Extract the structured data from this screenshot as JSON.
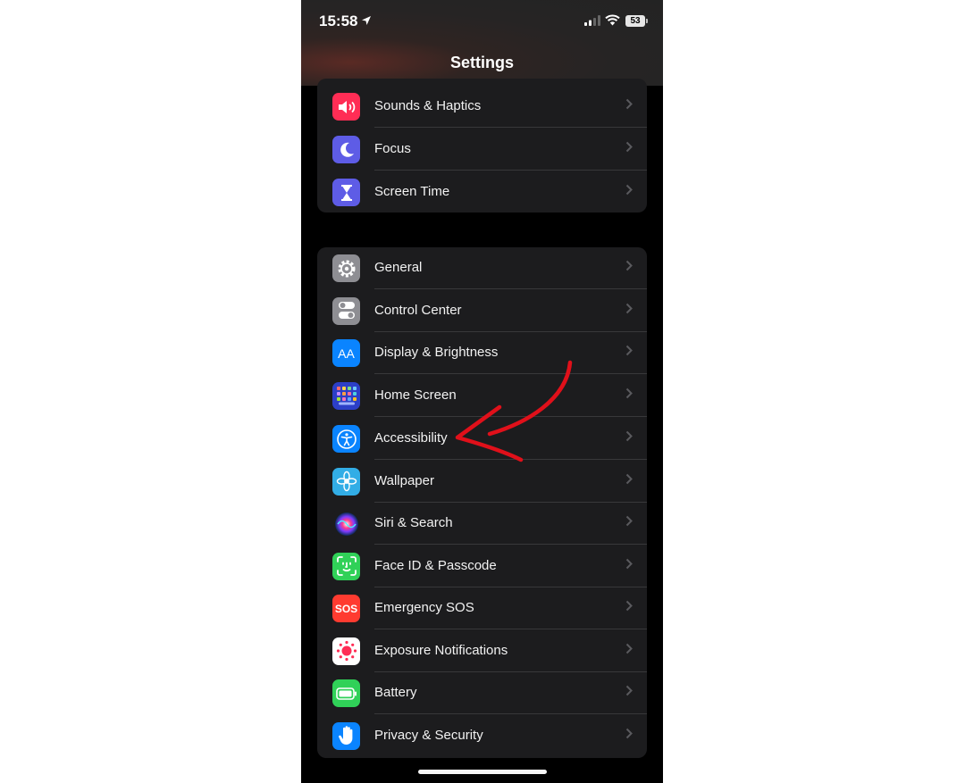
{
  "status_bar": {
    "time": "15:58",
    "battery": "53"
  },
  "nav": {
    "title": "Settings"
  },
  "group1": [
    {
      "label": "Sounds & Haptics",
      "icon": "speaker-icon",
      "color": "#ff2d55"
    },
    {
      "label": "Focus",
      "icon": "moon-icon",
      "color": "#5e5ce6"
    },
    {
      "label": "Screen Time",
      "icon": "hourglass-icon",
      "color": "#5e5ce6"
    }
  ],
  "group2": [
    {
      "label": "General",
      "icon": "gear-icon",
      "color": "#8e8e93"
    },
    {
      "label": "Control Center",
      "icon": "toggles-icon",
      "color": "#8e8e93"
    },
    {
      "label": "Display & Brightness",
      "icon": "text-size-icon",
      "color": "#0a84ff",
      "icon_text": "AA"
    },
    {
      "label": "Home Screen",
      "icon": "app-grid-icon",
      "color": "#2c3fc7"
    },
    {
      "label": "Accessibility",
      "icon": "accessibility-icon",
      "color": "#0a84ff"
    },
    {
      "label": "Wallpaper",
      "icon": "flower-icon",
      "color": "#32ade6"
    },
    {
      "label": "Siri & Search",
      "icon": "siri-icon",
      "color": "#1c1c1e"
    },
    {
      "label": "Face ID & Passcode",
      "icon": "face-id-icon",
      "color": "#30d158"
    },
    {
      "label": "Emergency SOS",
      "icon": "sos-icon",
      "color": "#ff3b30",
      "icon_text": "SOS"
    },
    {
      "label": "Exposure Notifications",
      "icon": "exposure-icon",
      "color": "#ffffff"
    },
    {
      "label": "Battery",
      "icon": "battery-icon",
      "color": "#30d158"
    },
    {
      "label": "Privacy & Security",
      "icon": "hand-icon",
      "color": "#0a84ff"
    }
  ],
  "annotation": {
    "color": "#e0101a",
    "target": "Accessibility"
  }
}
